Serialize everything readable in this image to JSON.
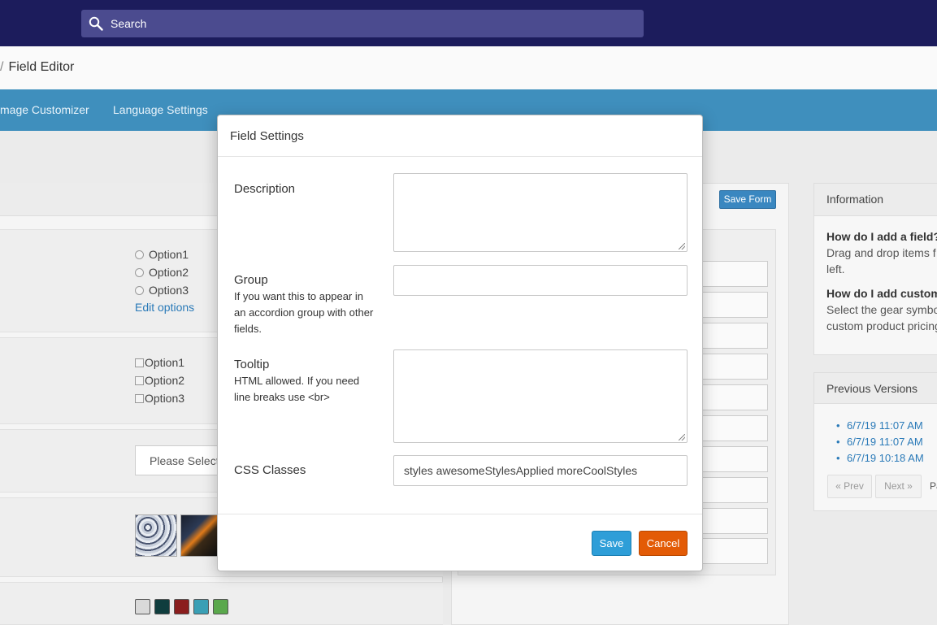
{
  "search": {
    "placeholder": "Search"
  },
  "breadcrumb": {
    "separator": "/",
    "current": "Field Editor"
  },
  "nav": {
    "items": [
      "mage Customizer",
      "Language Settings"
    ]
  },
  "left_panel": {
    "radio_options": [
      "Option1",
      "Option2",
      "Option3"
    ],
    "edit_options_link": "Edit options",
    "checkbox_options": [
      "Option1",
      "Option2",
      "Option3"
    ],
    "select_text": "Please Select",
    "swatch_colors": [
      "#d9d9d9",
      "#0f3d3e",
      "#8b1e1e",
      "#3a9fb5",
      "#5aa84c"
    ]
  },
  "mid_panel": {
    "save_form_label": "Save Form"
  },
  "info_panel": {
    "title": "Information",
    "q1": "How do I add a field?",
    "a1_line1": "Drag and drop items f",
    "a1_line2": "left.",
    "q2": "How do I add custom",
    "a2_line1": "Select the gear symbo",
    "a2_line2": "custom product pricing"
  },
  "versions_panel": {
    "title": "Previous Versions",
    "versions": [
      "6/7/19 11:07 AM",
      "6/7/19 11:07 AM",
      "6/7/19 10:18 AM"
    ],
    "prev_label": "« Prev",
    "next_label": "Next »",
    "page_label": "Pa"
  },
  "modal": {
    "title": "Field Settings",
    "description_label": "Description",
    "description_value": "",
    "group_label": "Group",
    "group_help": "If you want this to appear in an accordion group with other fields.",
    "group_value": "",
    "tooltip_label": "Tooltip",
    "tooltip_help": "HTML allowed. If you need line breaks use <br>",
    "tooltip_value": "",
    "css_label": "CSS Classes",
    "css_value": "styles awesomeStylesApplied moreCoolStyles",
    "save_label": "Save",
    "cancel_label": "Cancel"
  }
}
